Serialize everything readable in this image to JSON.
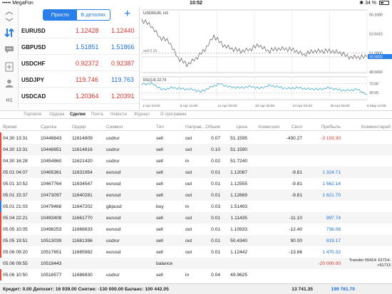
{
  "status_bar": {
    "carrier": "••••• MegaFon",
    "time": "10:52",
    "battery": "34 %"
  },
  "quotes_panel": {
    "segment_simple": "Просто",
    "segment_details": "В деталях",
    "rows": [
      {
        "symbol": "EURUSD",
        "bid": "1.12428",
        "ask": "1.12440",
        "bid_color": "red",
        "ask_color": "red"
      },
      {
        "symbol": "GBPUSD",
        "bid": "1.51851",
        "ask": "1.51866",
        "bid_color": "blue",
        "ask_color": "blue"
      },
      {
        "symbol": "USDCHF",
        "bid": "0.92372",
        "ask": "0.92387",
        "bid_color": "red",
        "ask_color": "red"
      },
      {
        "symbol": "USDJPY",
        "bid": "119.746",
        "ask": "119.763",
        "bid_color": "red",
        "ask_color": "blue"
      },
      {
        "symbol": "USDCAD",
        "bid": "1.20364",
        "ask": "1.20391",
        "bid_color": "red",
        "ask_color": "red"
      },
      {
        "symbol": "AUDUSD",
        "bid": "0.79279",
        "ask": "0.79290",
        "bid_color": "red",
        "ask_color": "red"
      }
    ]
  },
  "sidebar": {
    "h1_label": "H1"
  },
  "chart": {
    "title": "USDRUR, H1",
    "sell_label": "sell 0.15",
    "price_labels": [
      "56.1680",
      "53.6410",
      "51.0800",
      "50.5820",
      "48.5660"
    ],
    "rsi_label": "RSI(14) 22.79",
    "rsi_levels": [
      "70.00",
      "30.00"
    ],
    "x_labels": [
      "2 Apr 04:00",
      "8 Apr 12:00",
      "14 Apr 06:00",
      "20 Apr 00:00",
      "24 Apr 02:00",
      "30 Apr 06:00",
      "6 May 10:00"
    ]
  },
  "chart_data": {
    "type": "line",
    "title": "USDRUR, H1",
    "x": [
      "2 Apr 04:00",
      "8 Apr 12:00",
      "14 Apr 06:00",
      "20 Apr 00:00",
      "24 Apr 02:00",
      "30 Apr 06:00",
      "6 May 10:00"
    ],
    "series": [
      {
        "values": [
          55.4,
          54.8,
          53.1,
          52.7,
          50.4,
          49.6,
          50.3,
          51.6,
          53.3,
          52.2,
          51.6,
          51.4,
          51.5,
          52.2,
          51.3,
          51.7,
          51.6,
          51.5,
          50.8,
          51.4,
          51.3,
          51.4,
          51.1,
          50.6,
          50.5,
          50.6
        ]
      },
      {
        "name": "RSI(14)",
        "values": [
          68,
          72,
          45,
          52,
          48,
          46,
          35,
          54,
          70,
          55,
          52,
          58,
          50,
          62,
          55,
          49,
          52,
          47,
          45,
          52,
          44,
          40,
          45,
          23
        ]
      }
    ],
    "ylim": [
      48.5,
      56.8
    ],
    "rsi_levels": [
      70,
      30
    ],
    "current_price": 50.582,
    "sell_level": 51.08
  },
  "tabs": [
    "Торговля",
    "Ордера",
    "Сделки",
    "Почта",
    "Новости",
    "Журнал",
    "О программе"
  ],
  "active_tab": "Сделки",
  "table": {
    "headers": [
      "Время",
      "Сделка",
      "Ордер",
      "Символ",
      "Тип",
      "Направ...",
      "Объем",
      "Цена",
      "Комиссия",
      "Своп",
      "Прибыль",
      "Комментарий"
    ],
    "rows": [
      {
        "time": "04.30 13:31",
        "deal": "10448843",
        "order": "11614809",
        "symbol": "usdrur",
        "type": "sell",
        "dir": "out",
        "volume": "0.07",
        "price": "51.1595",
        "commission": "",
        "swap": "-430.27",
        "profit": "-3 103.30",
        "profit_color": "red",
        "comment": "",
        "mark": "#e74c3c"
      },
      {
        "time": "04.30 13:31",
        "deal": "10448851",
        "order": "11614816",
        "symbol": "usdrur",
        "type": "sell",
        "dir": "out",
        "volume": "0.10",
        "price": "51.1590",
        "commission": "",
        "swap": "",
        "profit": "",
        "profit_color": "",
        "comment": "",
        "mark": "#e74c3c"
      },
      {
        "time": "04.30 16:28",
        "deal": "10454860",
        "order": "11621420",
        "symbol": "usdrur",
        "type": "sell",
        "dir": "in",
        "volume": "0.02",
        "price": "51.7240",
        "commission": "",
        "swap": "",
        "profit": "",
        "profit_color": "",
        "comment": "",
        "mark": "#e74c3c"
      },
      {
        "time": "05.01 04:07",
        "deal": "10465361",
        "order": "11631954",
        "symbol": "eurusd",
        "type": "sell",
        "dir": "out",
        "volume": "0.01",
        "price": "1.12087",
        "commission": "",
        "swap": "-9.81",
        "profit": "1 324.71",
        "profit_color": "blue",
        "comment": "",
        "mark": "#e74c3c"
      },
      {
        "time": "05.01 10:52",
        "deal": "10467764",
        "order": "11634547",
        "symbol": "eurusd",
        "type": "sell",
        "dir": "out",
        "volume": "0.01",
        "price": "1.12555",
        "commission": "",
        "swap": "-9.81",
        "profit": "1 562.14",
        "profit_color": "blue",
        "comment": "",
        "mark": "#e74c3c"
      },
      {
        "time": "05.01 15:37",
        "deal": "10473097",
        "order": "11640281",
        "symbol": "eurusd",
        "type": "sell",
        "dir": "out",
        "volume": "0.01",
        "price": "1.12669",
        "commission": "",
        "swap": "-9.81",
        "profit": "1 621.70",
        "profit_color": "blue",
        "comment": "",
        "mark": "#e74c3c"
      },
      {
        "time": "05.01 21:03",
        "deal": "10479468",
        "order": "11647202",
        "symbol": "gbpusd",
        "type": "buy",
        "dir": "in",
        "volume": "0.03",
        "price": "1.51493",
        "commission": "",
        "swap": "",
        "profit": "",
        "profit_color": "",
        "comment": "",
        "mark": "#2a7ee8"
      },
      {
        "time": "05.04 22:21",
        "deal": "10493408",
        "order": "11661770",
        "symbol": "eurusd",
        "type": "sell",
        "dir": "out",
        "volume": "0.01",
        "price": "1.11435",
        "commission": "",
        "swap": "-11.10",
        "profit": "997.74",
        "profit_color": "blue",
        "comment": "",
        "mark": "#e74c3c"
      },
      {
        "time": "05.05 10:05",
        "deal": "10498253",
        "order": "11666633",
        "symbol": "eurusd",
        "type": "sell",
        "dir": "out",
        "volume": "0.01",
        "price": "1.10933",
        "commission": "",
        "swap": "-12.40",
        "profit": "736.06",
        "profit_color": "blue",
        "comment": "",
        "mark": "#e74c3c"
      },
      {
        "time": "05.05 19:51",
        "deal": "10513039",
        "order": "11681396",
        "symbol": "usdrur",
        "type": "sell",
        "dir": "out",
        "volume": "0.01",
        "price": "50.4340",
        "commission": "",
        "swap": "90.00",
        "profit": "819.17",
        "profit_color": "blue",
        "comment": "",
        "mark": "#e74c3c"
      },
      {
        "time": "05.06 09:20",
        "deal": "10517651",
        "order": "11685982",
        "symbol": "eurusd",
        "type": "sell",
        "dir": "out",
        "volume": "0.01",
        "price": "1.12442",
        "commission": "",
        "swap": "-13.66",
        "profit": "1 470.32",
        "profit_color": "blue",
        "comment": "",
        "mark": "#e74c3c"
      },
      {
        "time": "05.06 09:55",
        "deal": "10518443",
        "order": "",
        "symbol": "",
        "type": "balance",
        "dir": "",
        "volume": "",
        "price": "",
        "commission": "",
        "swap": "",
        "profit": "-20 000.00",
        "profit_color": "red",
        "comment": "Transfer 55414: 61714->61713",
        "mark": ""
      },
      {
        "time": "05.06 10:50",
        "deal": "10518577",
        "order": "11686830",
        "symbol": "usdrur",
        "type": "sell",
        "dir": "in",
        "volume": "0.04",
        "price": "49.9625",
        "commission": "",
        "swap": "",
        "profit": "",
        "profit_color": "",
        "comment": "",
        "mark": "#e74c3c"
      }
    ]
  },
  "footer": {
    "summary": "Кредит: 0.00 Депозит: 16 939.00 Снятие: -130 000.00 Баланс: 100 442.05",
    "swap_total": "13 741.35",
    "profit_total": "199 761.70"
  }
}
